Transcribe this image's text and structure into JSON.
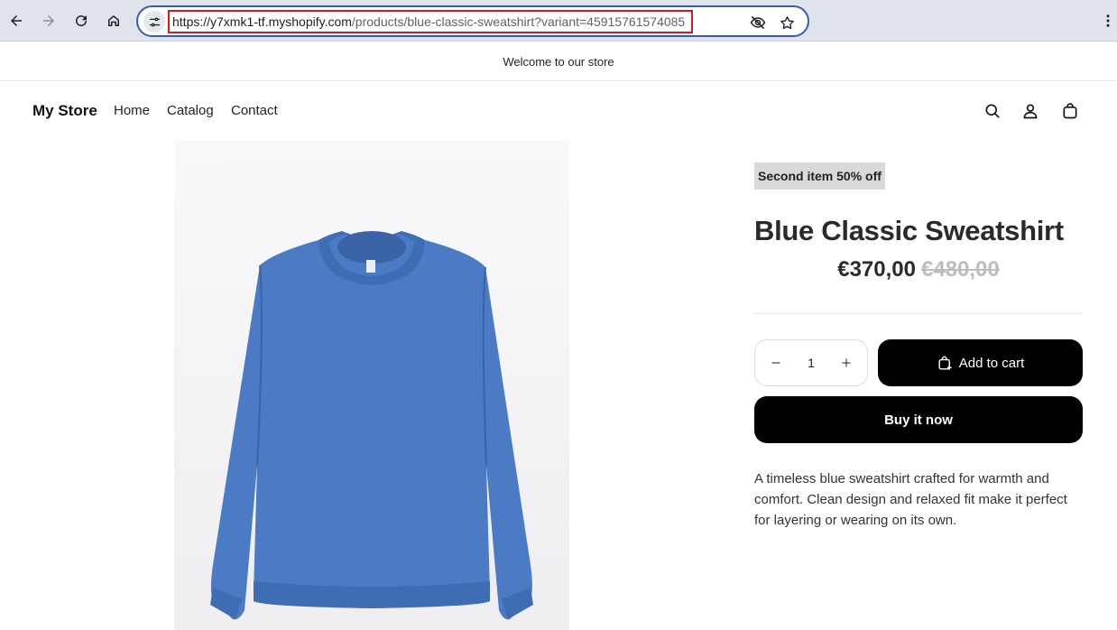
{
  "browser": {
    "url_host": "https://y7xmk1-tf.myshopify.com",
    "url_path": "/products/blue-classic-sweatshirt?variant=45915761574085",
    "icons": [
      "back-icon",
      "forward-icon",
      "reload-icon",
      "home-icon",
      "tune-icon",
      "eye-off-icon",
      "star-icon",
      "more-vert-icon"
    ]
  },
  "announcement": {
    "text": "Welcome to our store"
  },
  "header": {
    "store_name": "My Store",
    "nav": [
      {
        "label": "Home"
      },
      {
        "label": "Catalog"
      },
      {
        "label": "Contact"
      }
    ],
    "icons": [
      "search-icon",
      "account-icon",
      "cart-icon"
    ]
  },
  "product": {
    "badge": "Second item 50% off",
    "title": "Blue Classic Sweatshirt",
    "price": "€370,00",
    "compare_price": "€480,00",
    "quantity": "1",
    "add_to_cart": "Add to cart",
    "buy_now": "Buy it now",
    "description": "A timeless blue sweatshirt crafted for warmth and comfort. Clean design and relaxed fit make it perfect for layering or wearing on its own.",
    "image_color": "#4a7bc4"
  }
}
